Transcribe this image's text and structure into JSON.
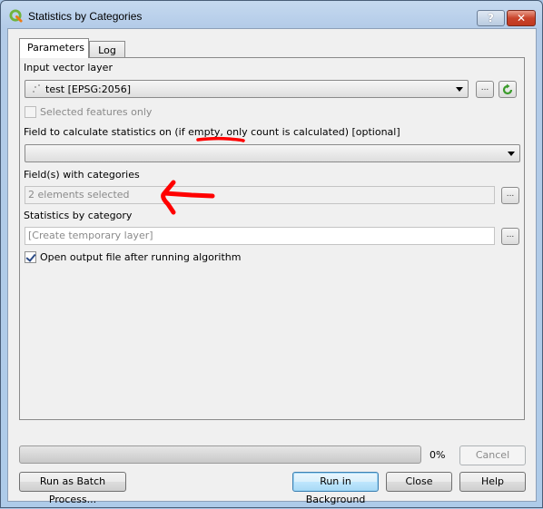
{
  "window": {
    "title": "Statistics by Categories",
    "help_button": "?",
    "close_button": "✕"
  },
  "tabs": [
    {
      "label": "Parameters",
      "active": true
    },
    {
      "label": "Log",
      "active": false
    }
  ],
  "parameters": {
    "input_layer_label": "Input vector layer",
    "input_layer_value": "test [EPSG:2056]",
    "input_layer_browse": "...",
    "selected_only_label": "Selected features only",
    "selected_only_checked": false,
    "field_label": "Field to calculate statistics on (if empty, only count is calculated) [optional]",
    "field_value": "",
    "categories_label": "Field(s) with categories",
    "categories_value": "2 elements selected",
    "categories_browse": "...",
    "output_label": "Statistics by category",
    "output_placeholder": "[Create temporary layer]",
    "output_browse": "...",
    "open_output_label": "Open output file after running algorithm",
    "open_output_checked": true
  },
  "progress": {
    "percent": 0,
    "label": "0%"
  },
  "buttons": {
    "cancel": "Cancel",
    "batch": "Run as Batch Process...",
    "run_background": "Run in Background",
    "close": "Close",
    "help": "Help"
  },
  "annotations": {
    "color": "#ff0000"
  }
}
